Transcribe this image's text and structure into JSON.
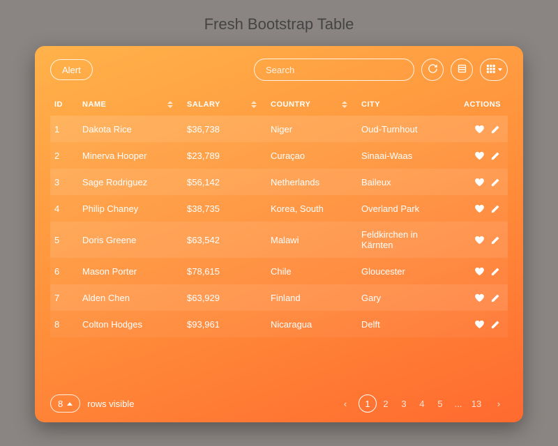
{
  "title": "Fresh Bootstrap Table",
  "toolbar": {
    "alert_label": "Alert",
    "search_placeholder": "Search"
  },
  "columns": {
    "id": "ID",
    "name": "NAME",
    "salary": "SALARY",
    "country": "COUNTRY",
    "city": "CITY",
    "actions": "ACTIONS"
  },
  "rows": [
    {
      "id": "1",
      "name": "Dakota Rice",
      "salary": "$36,738",
      "country": "Niger",
      "city": "Oud-Turnhout"
    },
    {
      "id": "2",
      "name": "Minerva Hooper",
      "salary": "$23,789",
      "country": "Curaçao",
      "city": "Sinaai-Waas"
    },
    {
      "id": "3",
      "name": "Sage Rodriguez",
      "salary": "$56,142",
      "country": "Netherlands",
      "city": "Baileux"
    },
    {
      "id": "4",
      "name": "Philip Chaney",
      "salary": "$38,735",
      "country": "Korea, South",
      "city": "Overland Park"
    },
    {
      "id": "5",
      "name": "Doris Greene",
      "salary": "$63,542",
      "country": "Malawi",
      "city": "Feldkirchen in Kärnten"
    },
    {
      "id": "6",
      "name": "Mason Porter",
      "salary": "$78,615",
      "country": "Chile",
      "city": "Gloucester"
    },
    {
      "id": "7",
      "name": "Alden Chen",
      "salary": "$63,929",
      "country": "Finland",
      "city": "Gary"
    },
    {
      "id": "8",
      "name": "Colton Hodges",
      "salary": "$93,961",
      "country": "Nicaragua",
      "city": "Delft"
    }
  ],
  "footer": {
    "rows_visible_value": "8",
    "rows_visible_label": "rows visible"
  },
  "pagination": {
    "pages": [
      "1",
      "2",
      "3",
      "4",
      "5",
      "...",
      "13"
    ],
    "active": "1"
  }
}
